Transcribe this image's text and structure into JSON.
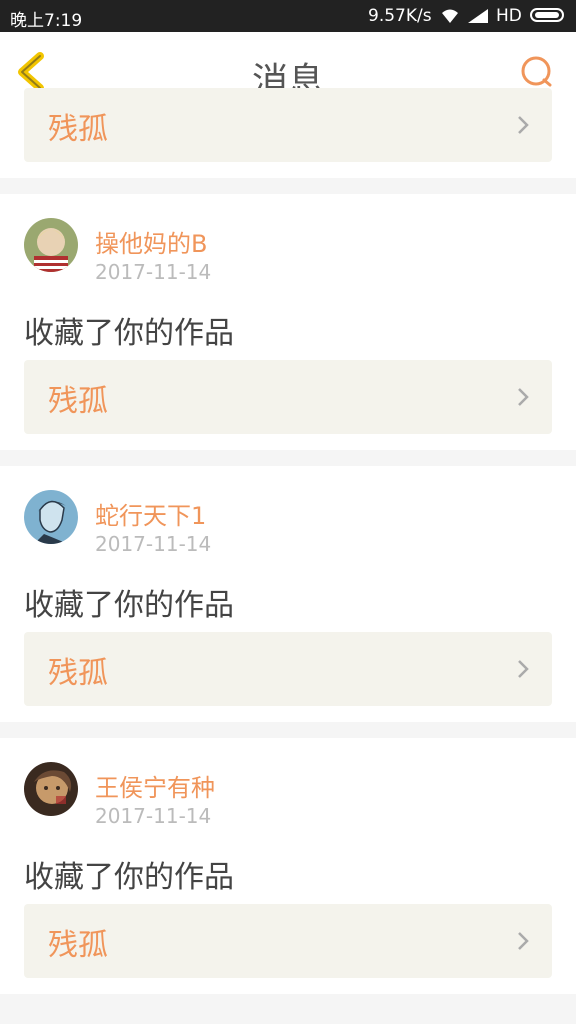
{
  "status_bar": {
    "time": "晚上7:19",
    "net_speed": "9.57K/s",
    "network": "HD"
  },
  "navbar": {
    "title": "消息"
  },
  "top_card": {
    "work_title": "残孤"
  },
  "messages": [
    {
      "username": "操他妈的B",
      "date": "2017-11-14",
      "action": "收藏了你的作品",
      "work_title": "残孤",
      "avatar_colors": [
        "#d9c7a8",
        "#b03030"
      ]
    },
    {
      "username": "蛇行天下1",
      "date": "2017-11-14",
      "action": "收藏了你的作品",
      "work_title": "残孤",
      "avatar_colors": [
        "#7fb2d0",
        "#2a3a4a"
      ]
    },
    {
      "username": "王侯宁有种",
      "date": "2017-11-14",
      "action": "收藏了你的作品",
      "work_title": "残孤",
      "avatar_colors": [
        "#6b4a34",
        "#c79a6a"
      ]
    }
  ],
  "colors": {
    "accent": "#f0955a",
    "back_icon": "#f2c500",
    "card_bg": "#f4f3ec"
  }
}
